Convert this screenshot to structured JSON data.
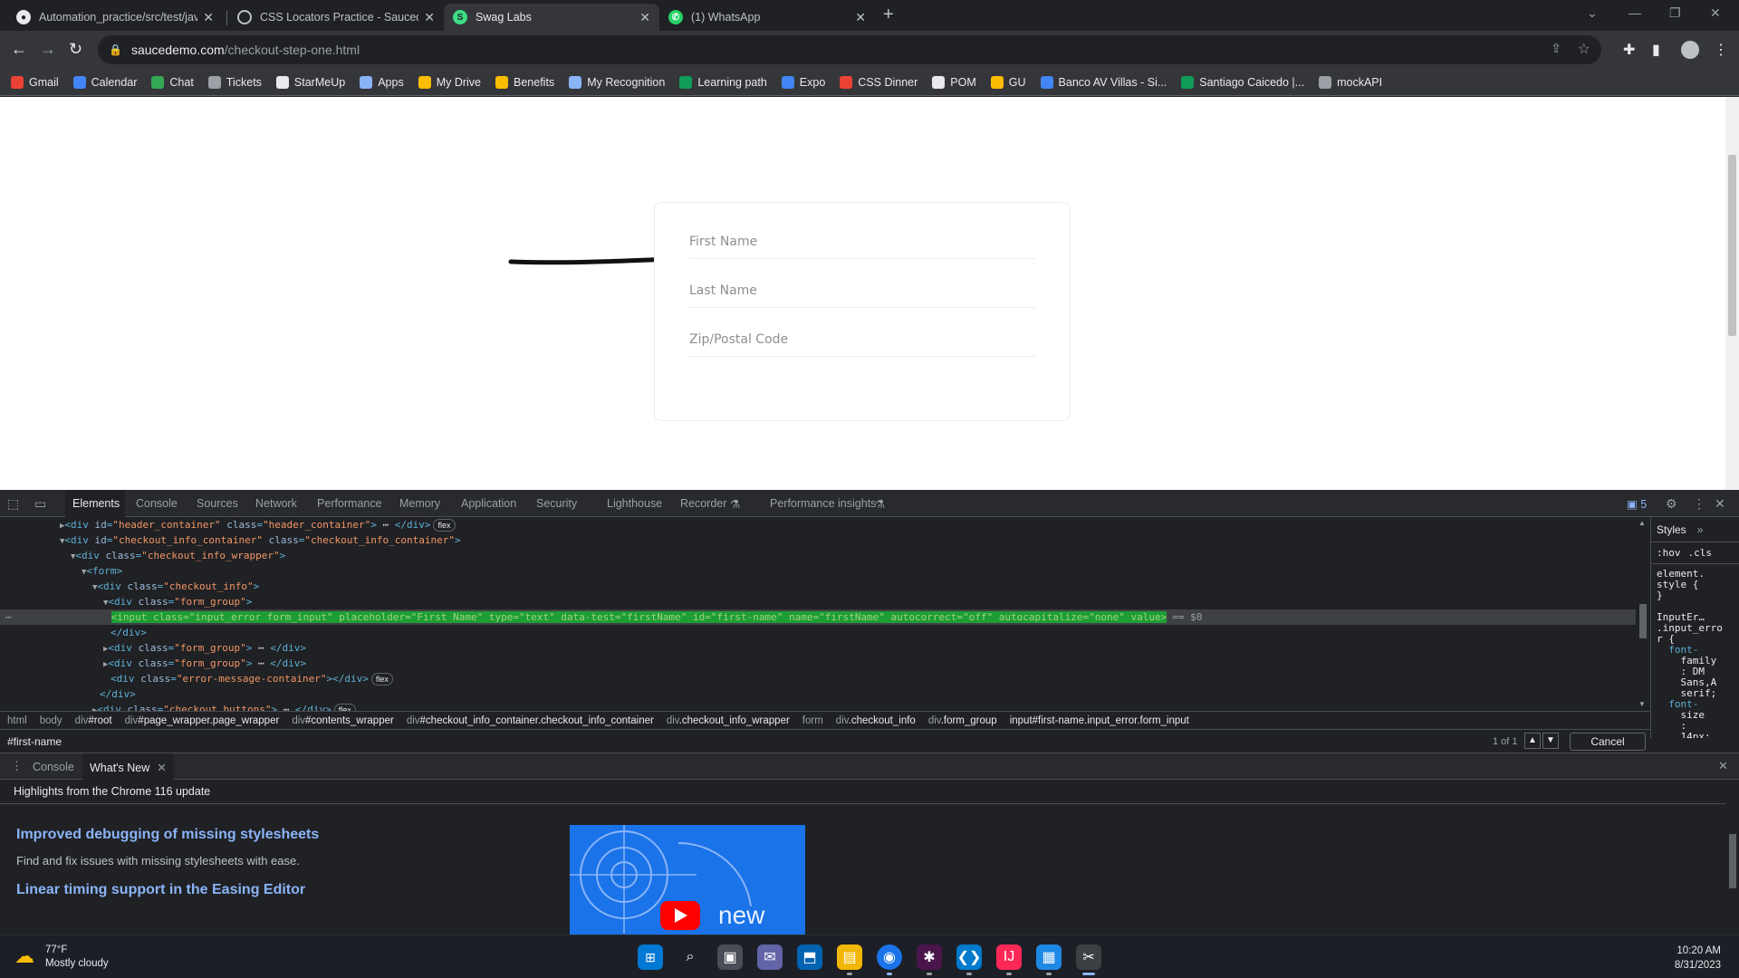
{
  "browser": {
    "tabs": [
      {
        "title": "Automation_practice/src/test/jav",
        "icon": "github-icon",
        "active": false
      },
      {
        "title": "CSS Locators Practice - Sauceden",
        "icon": "globe-icon",
        "active": false
      },
      {
        "title": "Swag Labs",
        "icon": "swag-labs-icon",
        "active": true
      },
      {
        "title": "(1) WhatsApp",
        "icon": "whatsapp-icon",
        "active": false
      }
    ],
    "url_host": "saucedemo.com",
    "url_path": "/checkout-step-one.html",
    "bookmarks": [
      {
        "label": "Gmail",
        "icon": "gmail-icon",
        "color": "#ea4335"
      },
      {
        "label": "Calendar",
        "icon": "calendar-icon",
        "color": "#4285f4"
      },
      {
        "label": "Chat",
        "icon": "chat-icon",
        "color": "#34a853"
      },
      {
        "label": "Tickets",
        "icon": "globe-icon",
        "color": "#9aa0a6"
      },
      {
        "label": "StarMeUp",
        "icon": "starmeup-icon",
        "color": "#e8eaed"
      },
      {
        "label": "Apps",
        "icon": "apps-icon",
        "color": "#8ab4f8"
      },
      {
        "label": "My Drive",
        "icon": "drive-icon",
        "color": "#fbbc04"
      },
      {
        "label": "Benefits",
        "icon": "benefits-icon",
        "color": "#fbbc04"
      },
      {
        "label": "My Recognition",
        "icon": "recognition-icon",
        "color": "#8ab4f8"
      },
      {
        "label": "Learning path",
        "icon": "sheets-icon",
        "color": "#0f9d58"
      },
      {
        "label": "Expo",
        "icon": "docs-icon",
        "color": "#4285f4"
      },
      {
        "label": "CSS Dinner",
        "icon": "css-dinner-icon",
        "color": "#ea4335"
      },
      {
        "label": "POM",
        "icon": "medium-icon",
        "color": "#e8eaed"
      },
      {
        "label": "GU",
        "icon": "gu-icon",
        "color": "#fbbc04"
      },
      {
        "label": "Banco AV Villas - Si...",
        "icon": "bank-icon",
        "color": "#4285f4"
      },
      {
        "label": "Santiago Caicedo |...",
        "icon": "sheets-icon",
        "color": "#0f9d58"
      },
      {
        "label": "mockAPI",
        "icon": "mockapi-icon",
        "color": "#9aa0a6"
      }
    ]
  },
  "form": {
    "first_name_placeholder": "First Name",
    "last_name_placeholder": "Last Name",
    "zip_placeholder": "Zip/Postal Code"
  },
  "devtools": {
    "tabs": [
      "Elements",
      "Console",
      "Sources",
      "Network",
      "Performance",
      "Memory",
      "Application",
      "Security",
      "Lighthouse",
      "Recorder",
      "Performance insights"
    ],
    "issues_count": "5",
    "styles_tab": "Styles",
    "styles_hov": ":hov",
    "styles_cls": ".cls",
    "styles_lines": [
      "element.",
      "style {",
      "}",
      "",
      "InputEr…",
      ".input_erro",
      "r {",
      "  font-",
      "    family",
      "    : DM",
      "    Sans,A",
      "    serif;",
      "  font-",
      "    size",
      "    :",
      "    14px;"
    ],
    "crumbs": [
      {
        "tag": "html",
        "rest": ""
      },
      {
        "tag": "body",
        "rest": ""
      },
      {
        "tag": "div",
        "rest": "#root"
      },
      {
        "tag": "div",
        "rest": "#page_wrapper.page_wrapper"
      },
      {
        "tag": "div",
        "rest": "#contents_wrapper"
      },
      {
        "tag": "div",
        "rest": "#checkout_info_container.checkout_info_container"
      },
      {
        "tag": "div",
        "rest": ".checkout_info_wrapper"
      },
      {
        "tag": "form",
        "rest": ""
      },
      {
        "tag": "div",
        "rest": ".checkout_info"
      },
      {
        "tag": "div",
        "rest": ".form_group"
      },
      {
        "tag": "input",
        "rest": "#first-name.input_error.form_input"
      }
    ],
    "search_query": "#first-name",
    "search_count": "1 of 1",
    "cancel_label": "Cancel",
    "drawer_tabs": [
      "Console",
      "What's New"
    ],
    "drawer_header": "Highlights from the Chrome 116 update",
    "drawer_h1": "Improved debugging of missing stylesheets",
    "drawer_p1": "Find and fix issues with missing stylesheets with ease.",
    "drawer_h2": "Linear timing support in the Easing Editor",
    "video_text": "new",
    "selected_suffix": "== $0"
  },
  "taskbar": {
    "weather_temp": "77°F",
    "weather_desc": "Mostly cloudy",
    "time": "10:20 AM",
    "date": "8/31/2023"
  }
}
